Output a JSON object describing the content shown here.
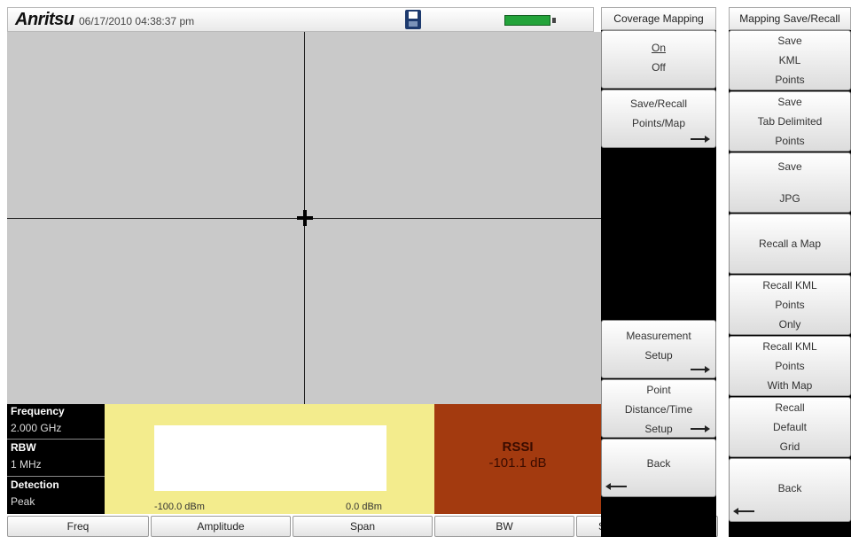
{
  "header": {
    "brand": "Anritsu",
    "datetime": "06/17/2010 04:38:37 pm",
    "battery_level": 0.9,
    "disk_icon": "floppy-disk-icon",
    "battery_icon": "battery-icon"
  },
  "info": {
    "frequency_label": "Frequency",
    "frequency_value": "2.000 GHz",
    "rbw_label": "RBW",
    "rbw_value": "1 MHz",
    "detection_label": "Detection",
    "detection_value": "Peak"
  },
  "meter": {
    "min_label": "-100.0 dBm",
    "max_label": "0.0 dBm"
  },
  "rssi": {
    "label": "RSSI",
    "value": "-101.1 dB"
  },
  "bottom_keys": [
    "Freq",
    "Amplitude",
    "Span",
    "BW",
    "Start Data Collection"
  ],
  "menu": {
    "title": "Coverage Mapping",
    "on": "On",
    "off": "Off",
    "save_recall_1": "Save/Recall",
    "save_recall_2": "Points/Map",
    "measurement_1": "Measurement",
    "measurement_2": "Setup",
    "point_1": "Point",
    "point_2": "Distance/Time",
    "point_3": "Setup",
    "back": "Back"
  },
  "panel2": {
    "title": "Mapping Save/Recall",
    "k1": [
      "Save",
      "KML",
      "Points"
    ],
    "k2": [
      "Save",
      "Tab Delimited",
      "Points"
    ],
    "k3": [
      "Save",
      "JPG"
    ],
    "k4": "Recall a Map",
    "k5": [
      "Recall KML",
      "Points",
      "Only"
    ],
    "k6": [
      "Recall KML",
      "Points",
      "With Map"
    ],
    "k7": [
      "Recall",
      "Default",
      "Grid"
    ],
    "k8": "Back"
  },
  "colors": {
    "meter_bg": "#f3ec8d",
    "rssi_bg": "#a33a0f",
    "battery": "#23a33a"
  }
}
